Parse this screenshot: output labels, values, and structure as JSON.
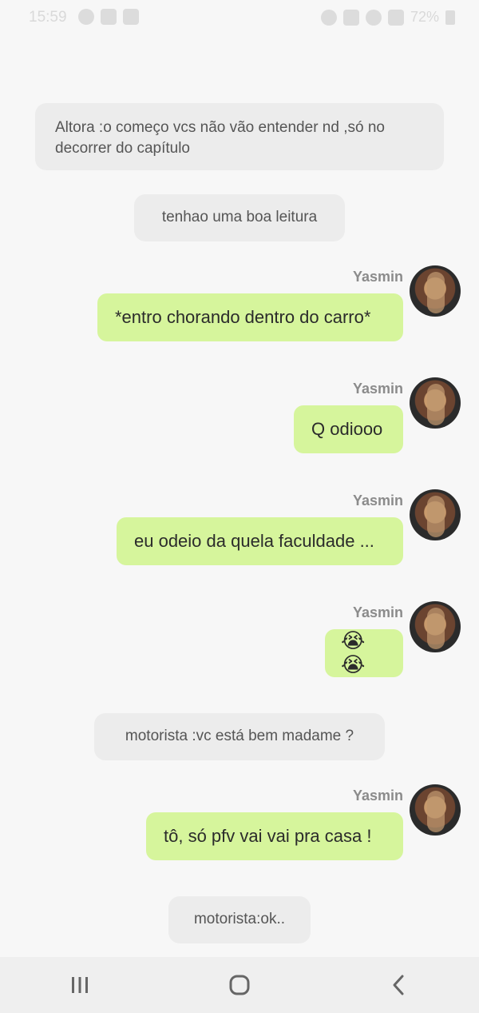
{
  "status_bar": {
    "time": "15:59",
    "battery": "72%",
    "left_icons": [
      "settings-icon",
      "instagram-icon",
      "voicemail-icon"
    ],
    "right_icons": [
      "alarm-icon",
      "mute-icon",
      "wifi-icon",
      "signal-icon",
      "battery-icon"
    ]
  },
  "messages": [
    {
      "type": "narration",
      "text": "Altora :o começo vcs não vão entender nd ,só no decorrer do capítulo"
    },
    {
      "type": "narration",
      "text": "tenhao uma boa leitura"
    },
    {
      "type": "outgoing",
      "sender": "Yasmin",
      "text": "*entro chorando dentro do carro*"
    },
    {
      "type": "outgoing",
      "sender": "Yasmin",
      "text": "Q odiooo"
    },
    {
      "type": "outgoing",
      "sender": "Yasmin",
      "text": "eu odeio da quela faculdade ..."
    },
    {
      "type": "outgoing",
      "sender": "Yasmin",
      "text": "😭😭"
    },
    {
      "type": "narration",
      "text": "motorista :vc está bem madame ?"
    },
    {
      "type": "outgoing",
      "sender": "Yasmin",
      "text": "tô, só pfv vai vai pra  casa !"
    },
    {
      "type": "narration",
      "text": "motorista:ok.."
    }
  ],
  "nav_bar": {
    "recents": "recents-icon",
    "home": "home-icon",
    "back": "back-icon"
  },
  "colors": {
    "outgoing_bubble": "#d6f59c",
    "narration_bubble": "#ececec",
    "background": "#f7f7f7",
    "nav_bar": "#efefef"
  }
}
